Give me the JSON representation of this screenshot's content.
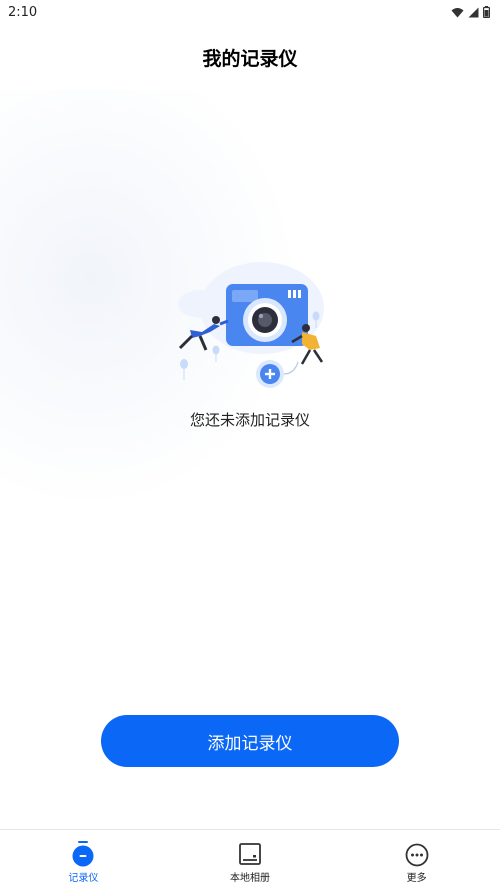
{
  "status_bar": {
    "time": "2:10"
  },
  "header": {
    "title": "我的记录仪"
  },
  "empty_state": {
    "message": "您还未添加记录仪"
  },
  "actions": {
    "add_button_label": "添加记录仪"
  },
  "tab_bar": {
    "items": [
      {
        "label": "记录仪",
        "icon": "recorder-icon",
        "active": true
      },
      {
        "label": "本地相册",
        "icon": "album-icon",
        "active": false
      },
      {
        "label": "更多",
        "icon": "more-icon",
        "active": false
      }
    ]
  },
  "colors": {
    "accent": "#0b67f5",
    "illustration_blue": "#4a86f0"
  }
}
